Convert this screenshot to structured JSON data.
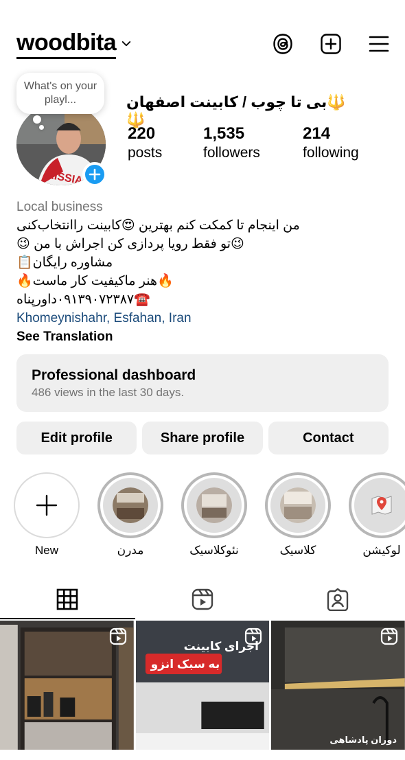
{
  "header": {
    "username": "woodbita"
  },
  "profile": {
    "note_bubble": "What's on your playl...",
    "full_name": "🔱بی تا چوب / کابینت اصفهان🔱",
    "stats": [
      {
        "value": "220",
        "label": "posts"
      },
      {
        "value": "1,535",
        "label": "followers"
      },
      {
        "value": "214",
        "label": "following"
      }
    ]
  },
  "bio": {
    "category": "Local business",
    "lines": [
      "من اینجام تا کمکت کنم بهترین 😍کابینت راانتخاب‌کنی",
      "😉تو فقط رویا پردازی کن اجراش با من 😉",
      "مشاوره رایگان📋",
      "🔥هنر ماکیفیت کار ماست🔥",
      "☎️۰۹۱۳۹۰۷۲۳۸۷داورپناه"
    ],
    "location": "Khomeynishahr, Esfahan, Iran",
    "see_translation": "See Translation"
  },
  "dashboard": {
    "title": "Professional dashboard",
    "subtitle": "486 views in the last 30 days."
  },
  "actions": {
    "edit": "Edit profile",
    "share": "Share profile",
    "contact": "Contact"
  },
  "highlights": [
    {
      "label": "New"
    },
    {
      "label": "مدرن"
    },
    {
      "label": "نئوکلاسیک"
    },
    {
      "label": "کلاسیک"
    },
    {
      "label": "لوکیشن"
    }
  ],
  "grid": {
    "post2_line1": "اجرای کابینت",
    "post2_line2": "به سبک انزو",
    "post3_caption": "دوران پادشاهی"
  }
}
